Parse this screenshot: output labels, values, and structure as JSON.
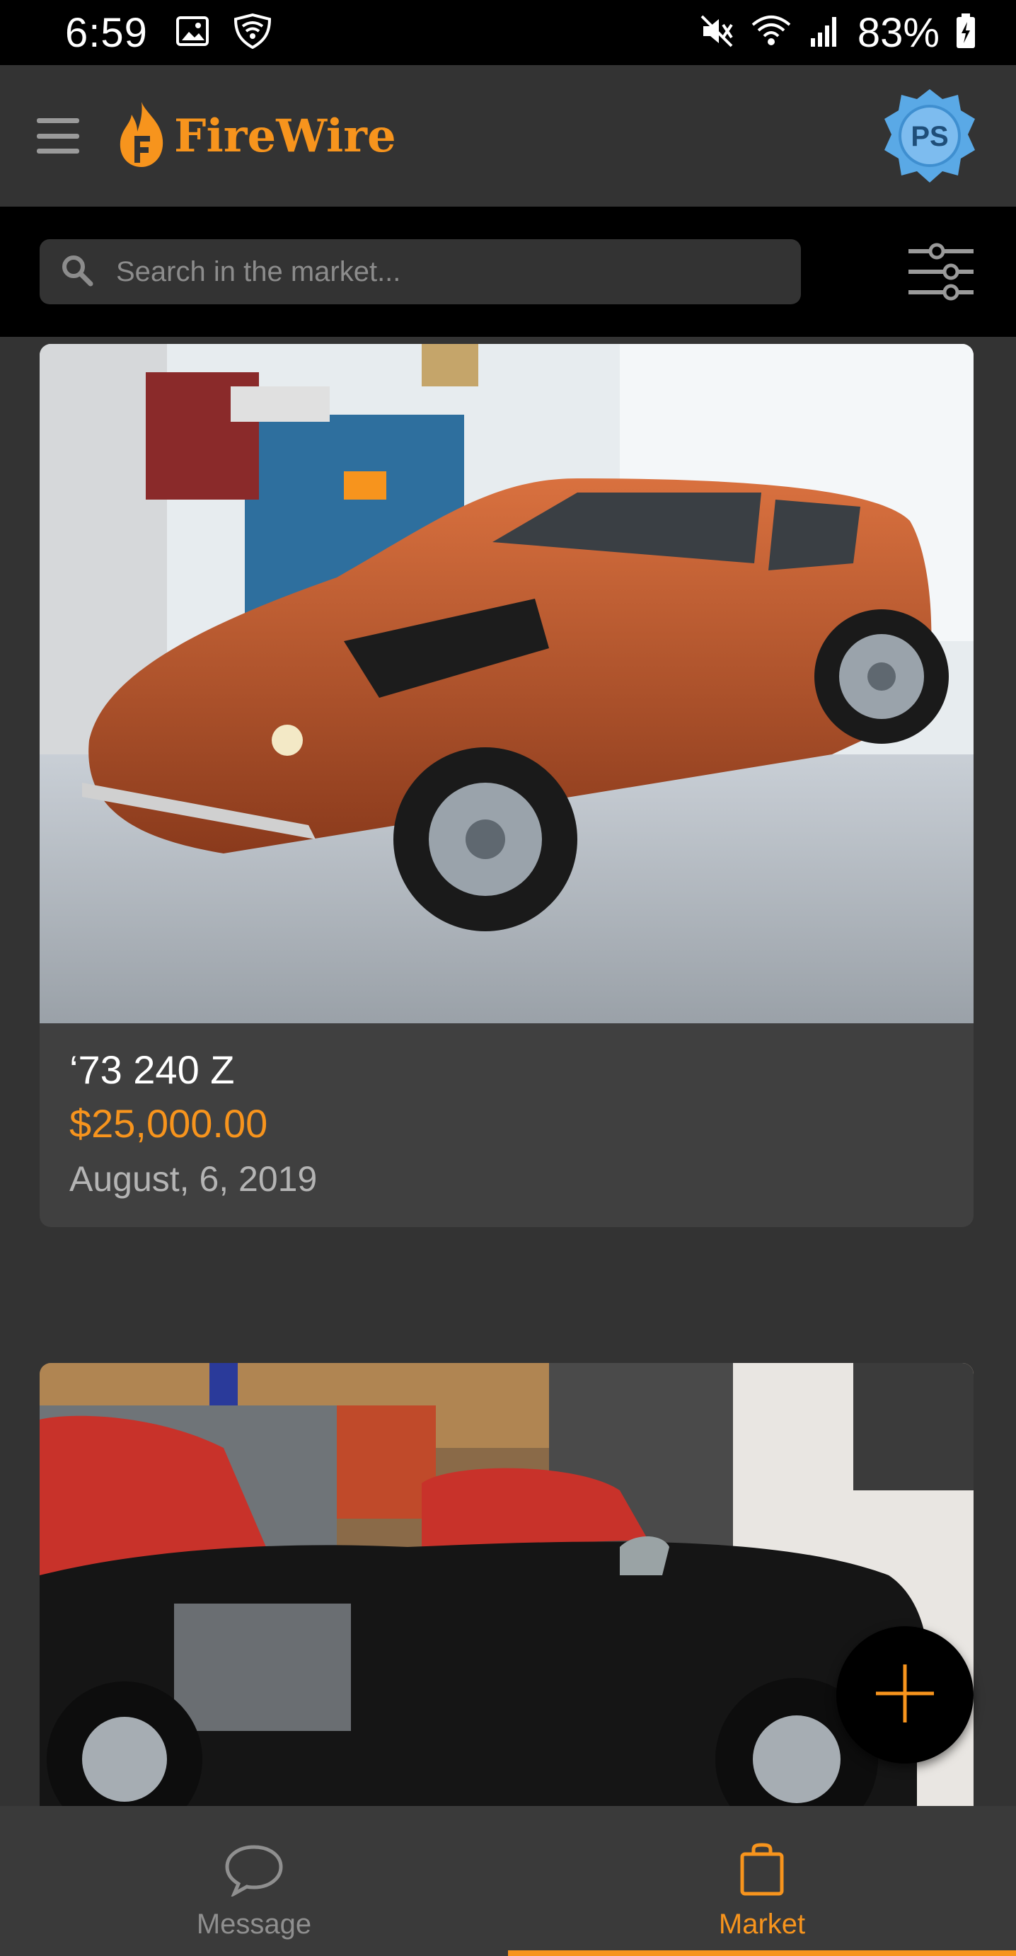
{
  "status_bar": {
    "time": "6:59",
    "battery_percent": "83%",
    "icons": [
      "gallery-icon",
      "shield-wifi-icon",
      "mute-icon",
      "wifi-icon",
      "signal-icon",
      "battery-charging-icon"
    ]
  },
  "app_bar": {
    "brand_name": "FireWire",
    "avatar_initials": "PS",
    "menu_icon": "hamburger-menu-icon",
    "logo_icon": "flame-logo-icon"
  },
  "search": {
    "placeholder": "Search in the market...",
    "value": "",
    "search_icon": "search-icon",
    "filter_icon": "filter-sliders-icon"
  },
  "listings": [
    {
      "title": "‘73 240 Z",
      "price": "$25,000.00",
      "date": "August, 6, 2019",
      "photo": "orange classic sports car in garage"
    },
    {
      "title": "",
      "price": "",
      "date": "",
      "photo": "black vintage roadster in garage"
    }
  ],
  "fab": {
    "icon": "plus-icon"
  },
  "bottom_nav": {
    "items": [
      {
        "label": "Message",
        "icon": "chat-bubble-icon",
        "active": false
      },
      {
        "label": "Market",
        "icon": "shopping-bag-icon",
        "active": true
      }
    ]
  },
  "colors": {
    "accent": "#f7941d",
    "background": "#333333",
    "card": "#404040",
    "status_bar": "#000000"
  }
}
